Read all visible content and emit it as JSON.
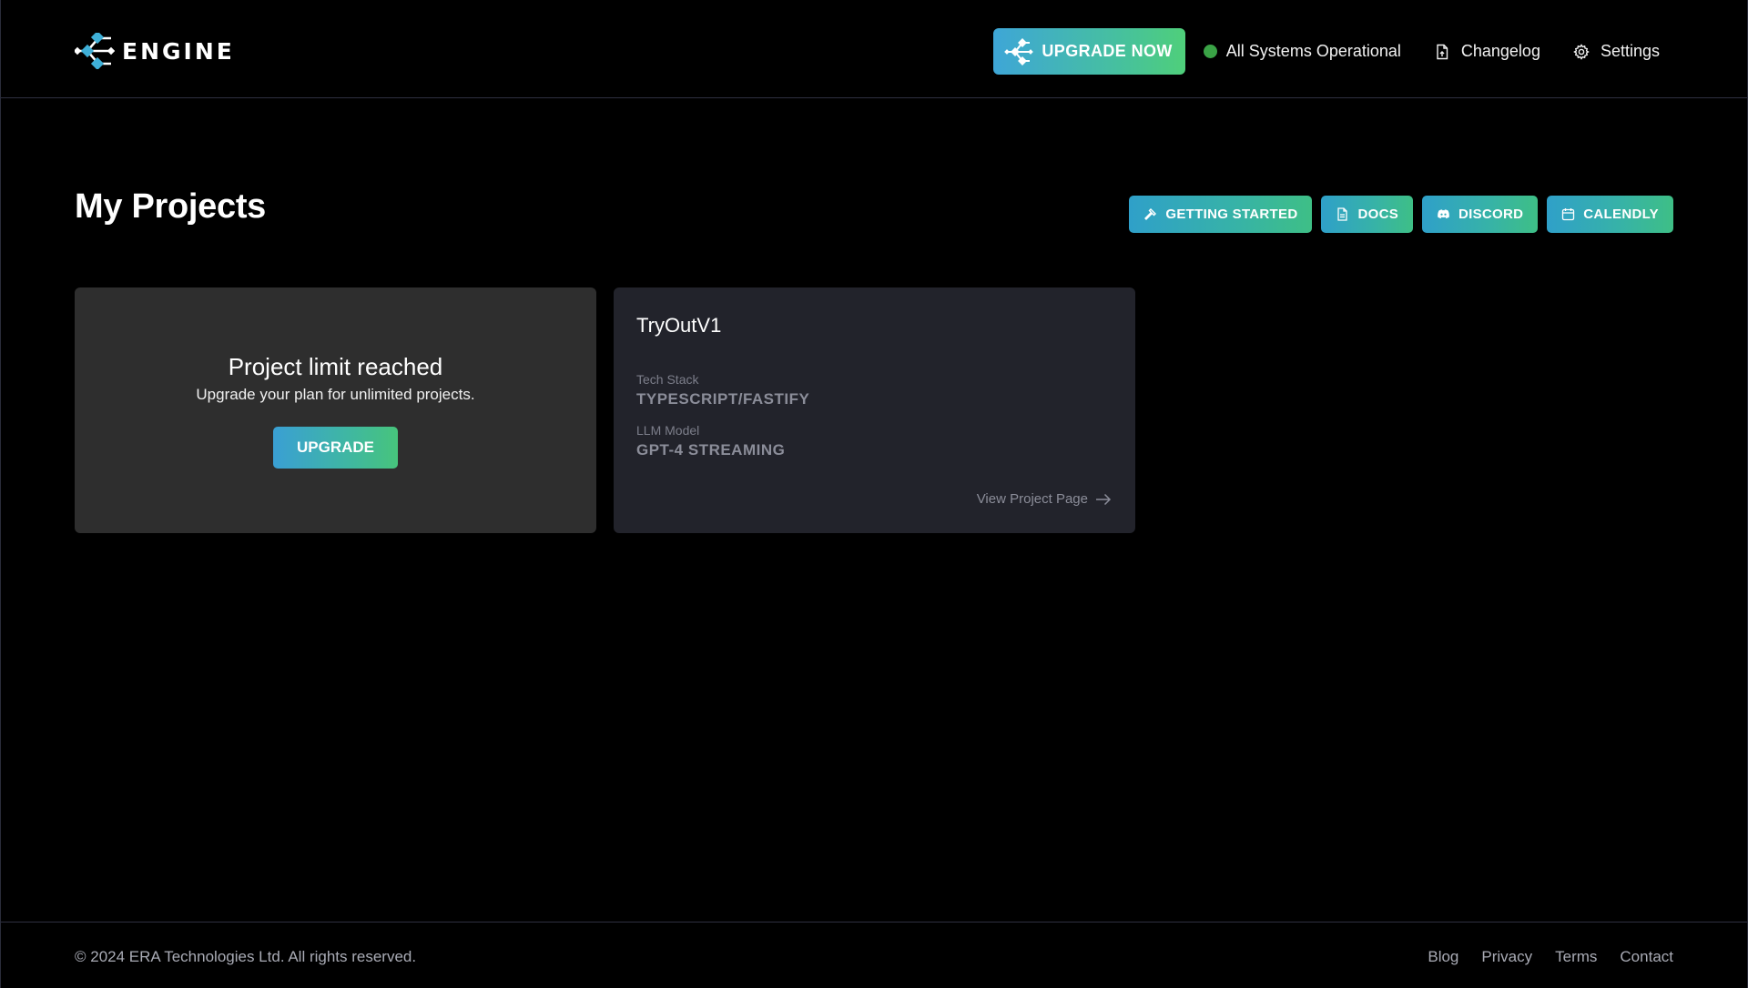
{
  "header": {
    "logo_text": "ENGINE",
    "upgrade_now_label": "UPGRADE NOW",
    "status_text": "All Systems Operational",
    "changelog_label": "Changelog",
    "settings_label": "Settings"
  },
  "main": {
    "title": "My Projects",
    "quick_links": [
      {
        "label": "GETTING STARTED",
        "icon": "hammer-icon"
      },
      {
        "label": "DOCS",
        "icon": "document-icon"
      },
      {
        "label": "DISCORD",
        "icon": "discord-icon"
      },
      {
        "label": "CALENDLY",
        "icon": "calendar-icon"
      }
    ],
    "limit_card": {
      "title": "Project limit reached",
      "subtitle": "Upgrade your plan for unlimited projects.",
      "button_label": "UPGRADE"
    },
    "project_card": {
      "name": "TryOutV1",
      "tech_stack_label": "Tech Stack",
      "tech_stack_value": "TYPESCRIPT/FASTIFY",
      "llm_label": "LLM Model",
      "llm_value": "GPT-4 STREAMING",
      "view_link": "View Project Page"
    }
  },
  "footer": {
    "copyright": "© 2024 ERA Technologies Ltd. All rights reserved.",
    "links": [
      "Blog",
      "Privacy",
      "Terms",
      "Contact"
    ]
  },
  "colors": {
    "background": "#000000",
    "accent_gradient_start": "#3ea6d7",
    "accent_gradient_end": "#4fcf7a",
    "status_green": "#3aa346"
  }
}
